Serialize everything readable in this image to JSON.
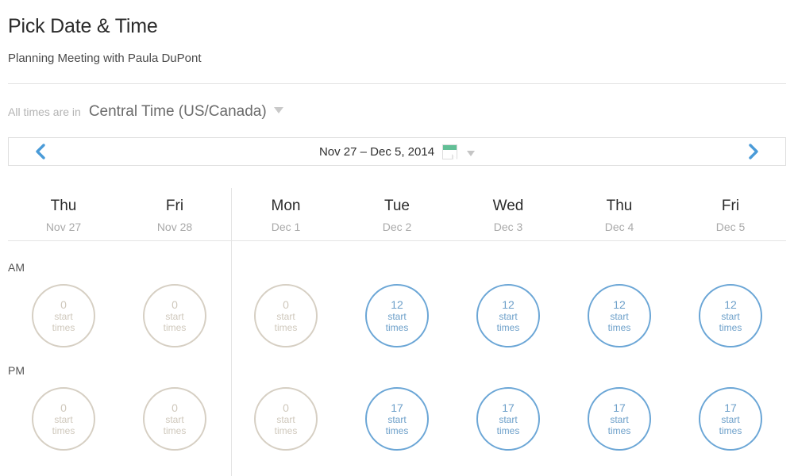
{
  "header": {
    "title": "Pick Date & Time",
    "subtitle": "Planning Meeting with Paula DuPont"
  },
  "timezone": {
    "prefix": "All times are in",
    "value": "Central Time (US/Canada)",
    "caret_icon": "chevron-down-icon"
  },
  "nav": {
    "prev_icon": "chevron-left-icon",
    "next_icon": "chevron-right-icon",
    "date_range": "Nov 27 – Dec 5, 2014",
    "calendar_icon": "calendar-icon",
    "caret_icon": "chevron-down-icon",
    "accent_blue": "#4a9bd8",
    "calendar_green": "#62bf96"
  },
  "grid": {
    "period_labels": {
      "am": "AM",
      "pm": "PM"
    },
    "slot_label": "start times",
    "colors": {
      "empty_border": "#d6cfc3",
      "empty_text": "#cfc8bc",
      "active_border": "#6ba6d6",
      "active_text": "#6c9fc9"
    },
    "columns": [
      {
        "day": "Thu",
        "date": "Nov 27",
        "am_count": "0",
        "pm_count": "0",
        "am_active": false,
        "pm_active": false
      },
      {
        "day": "Fri",
        "date": "Nov 28",
        "am_count": "0",
        "pm_count": "0",
        "am_active": false,
        "pm_active": false
      },
      {
        "day": "Mon",
        "date": "Dec 1",
        "am_count": "0",
        "pm_count": "0",
        "am_active": false,
        "pm_active": false
      },
      {
        "day": "Tue",
        "date": "Dec 2",
        "am_count": "12",
        "pm_count": "17",
        "am_active": true,
        "pm_active": true
      },
      {
        "day": "Wed",
        "date": "Dec 3",
        "am_count": "12",
        "pm_count": "17",
        "am_active": true,
        "pm_active": true
      },
      {
        "day": "Thu",
        "date": "Dec 4",
        "am_count": "12",
        "pm_count": "17",
        "am_active": true,
        "pm_active": true
      },
      {
        "day": "Fri",
        "date": "Dec 5",
        "am_count": "12",
        "pm_count": "17",
        "am_active": true,
        "pm_active": true
      }
    ]
  }
}
